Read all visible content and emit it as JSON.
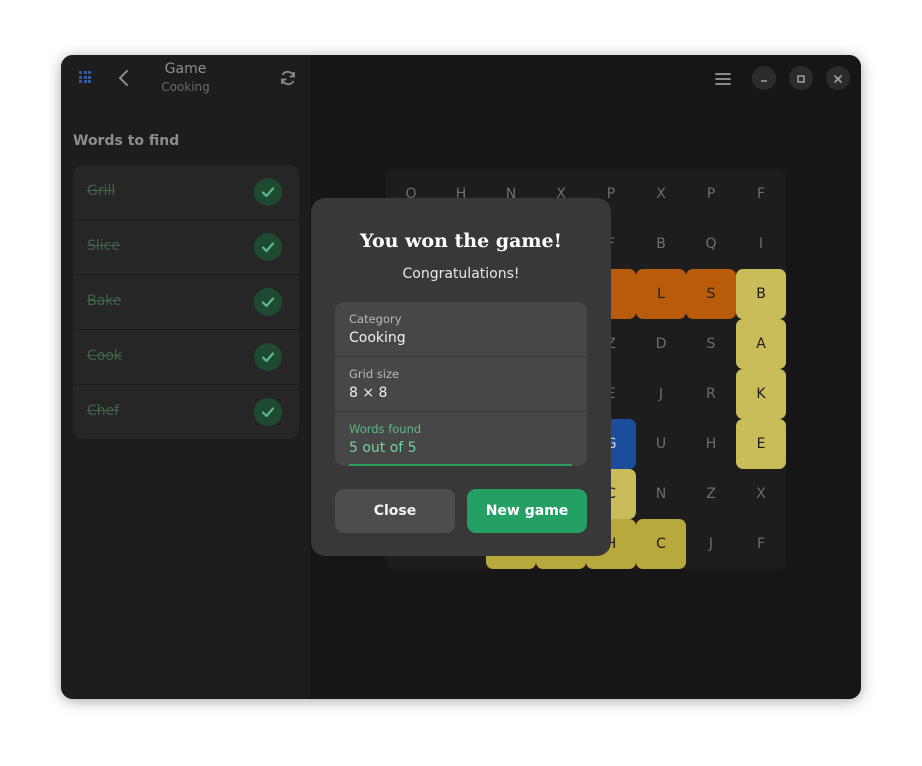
{
  "header": {
    "title": "Game",
    "subtitle": "Cooking"
  },
  "sidebar": {
    "heading": "Words to find",
    "words": [
      {
        "label": "Grill",
        "found": true
      },
      {
        "label": "Slice",
        "found": true
      },
      {
        "label": "Bake",
        "found": true
      },
      {
        "label": "Cook",
        "found": true
      },
      {
        "label": "Chef",
        "found": true
      }
    ]
  },
  "grid": {
    "rows": [
      [
        "O",
        "H",
        "N",
        "X",
        "P",
        "X",
        "P",
        "F"
      ],
      [
        "",
        "",
        "",
        "",
        "F",
        "B",
        "Q",
        "I"
      ],
      [
        "",
        "",
        "",
        "",
        "",
        "L",
        "S",
        "B"
      ],
      [
        "",
        "",
        "",
        "",
        "Z",
        "D",
        "S",
        "A"
      ],
      [
        "",
        "",
        "",
        "",
        "E",
        "J",
        "R",
        "K"
      ],
      [
        "",
        "",
        "",
        "",
        "G",
        "U",
        "H",
        "E"
      ],
      [
        "",
        "",
        "",
        "",
        "C",
        "N",
        "Z",
        "X"
      ],
      [
        "",
        "",
        "",
        "",
        "H",
        "C",
        "J",
        "F"
      ]
    ]
  },
  "colors": {
    "accent": "#25a064",
    "found_green": "#74d39d",
    "highlight_orange": "#b85c0c",
    "highlight_yellow": "#b7a93b",
    "highlight_pale_yellow": "#c8bd58",
    "highlight_blue": "#1c4d9c"
  },
  "dialog": {
    "title": "You won the game!",
    "subtitle": "Congratulations!",
    "category_label": "Category",
    "category_value": "Cooking",
    "grid_size_label": "Grid size",
    "grid_size_value": "8 × 8",
    "words_found_label": "Words found",
    "words_found_value": "5 out of 5",
    "close_label": "Close",
    "new_game_label": "New game"
  }
}
